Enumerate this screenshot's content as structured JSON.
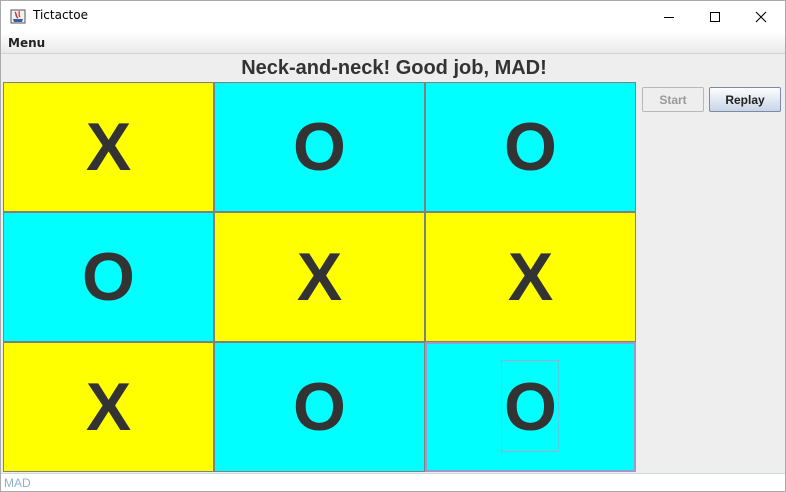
{
  "window": {
    "title": "Tictactoe",
    "icon": "java-app-icon",
    "controls": [
      "minimize-icon",
      "maximize-icon",
      "close-icon"
    ]
  },
  "menubar": {
    "menu_label": "Menu"
  },
  "game": {
    "status_message": "Neck-and-neck! Good job, MAD!",
    "board": [
      {
        "mark": "X",
        "color": "#ffff00"
      },
      {
        "mark": "O",
        "color": "#00ffff"
      },
      {
        "mark": "O",
        "color": "#00ffff"
      },
      {
        "mark": "O",
        "color": "#00ffff"
      },
      {
        "mark": "X",
        "color": "#ffff00"
      },
      {
        "mark": "X",
        "color": "#ffff00"
      },
      {
        "mark": "X",
        "color": "#ffff00"
      },
      {
        "mark": "O",
        "color": "#00ffff"
      },
      {
        "mark": "O",
        "color": "#00ffff"
      }
    ]
  },
  "controls": {
    "start_label": "Start",
    "start_enabled": false,
    "replay_label": "Replay"
  },
  "statusbar": {
    "player_name": "MAD"
  },
  "colors": {
    "x_cell": "#ffff00",
    "o_cell": "#00ffff",
    "mark_text": "#333333"
  }
}
